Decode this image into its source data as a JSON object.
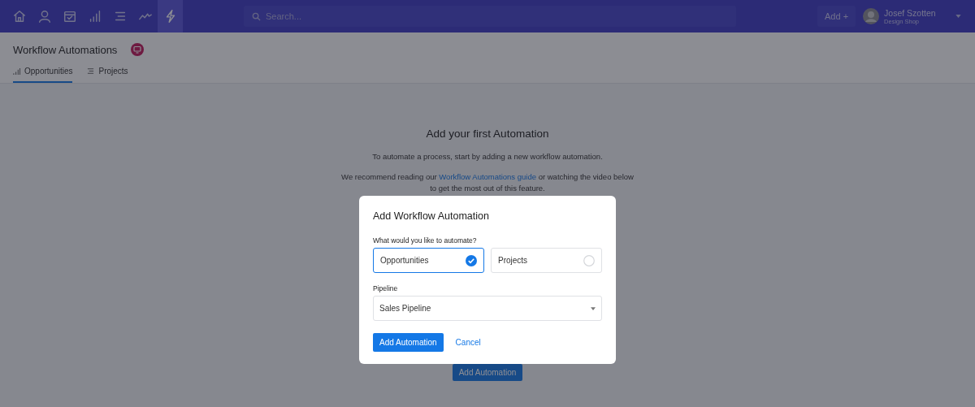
{
  "top_bar": {
    "nav_items": [
      {
        "selected": false
      },
      {
        "selected": false
      },
      {
        "selected": false
      },
      {
        "selected": false
      },
      {
        "selected": false
      },
      {
        "selected": false
      },
      {
        "selected": true
      }
    ],
    "search": {
      "placeholder": "Search..."
    },
    "add_button": "Add +",
    "user": {
      "name": "Josef Szotten",
      "company": "Design Shop"
    }
  },
  "page": {
    "title": "Workflow Automations",
    "tabs": [
      {
        "label": "Opportunities",
        "selected": true
      },
      {
        "label": "Projects",
        "selected": false
      }
    ],
    "empty_state": {
      "heading": "Add your first Automation",
      "text": "To automate a process, start by adding a new workflow automation.",
      "recommend_before": "We recommend reading our",
      "recommend_link": "Workflow Automations guide",
      "recommend_after": "or watching the video below",
      "recommend_line2": "to get the most out of this feature.",
      "button": "Add Automation"
    }
  },
  "dialog": {
    "title": "Add Workflow Automation",
    "question": "What would you like to automate?",
    "options": [
      {
        "label": "Opportunities",
        "selected": true
      },
      {
        "label": "Projects",
        "selected": false
      }
    ],
    "pipeline_label": "Pipeline",
    "pipeline_value": "Sales Pipeline",
    "primary_button": "Add Automation",
    "cancel_button": "Cancel"
  }
}
